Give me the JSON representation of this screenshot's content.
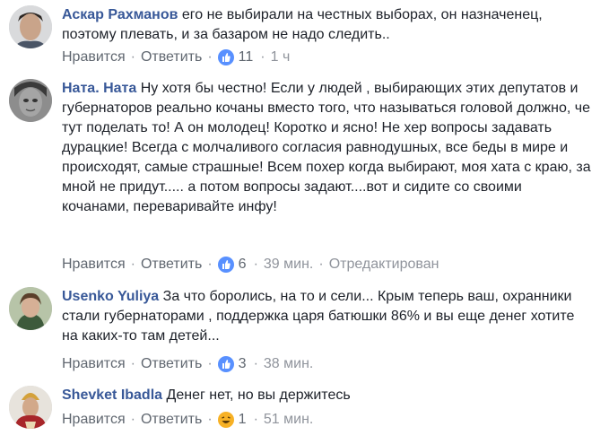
{
  "comments": [
    {
      "author": "Аскар Рахманов",
      "text": "его не выбирали на честных выборах, он назначенец, поэтому плевать, и за базаром не надо следить..",
      "like_label": "Нравится",
      "reply_label": "Ответить",
      "reaction": "like-icon",
      "reaction_count": "11",
      "time": "1 ч",
      "edited": ""
    },
    {
      "author": "Ната. Ната",
      "text": "Ну хотя бы честно! Если у людей , выбирающих этих депутатов и губернаторов реально кочаны вместо того, что называться головой должно, че тут поделать то! А он молодец! Коротко и ясно! Не хер вопросы задавать дурацкие! Всегда с молчаливого согласия равнодушных, все беды в мире и происходят, самые страшные! Всем похер когда выбирают, моя хата с краю, за мной не придут..... а потом вопросы задают....вот и сидите со своими кочанами, переваривайте инфу!",
      "like_label": "Нравится",
      "reply_label": "Ответить",
      "reaction": "like-icon",
      "reaction_count": "6",
      "time": "39 мин.",
      "edited": "Отредактирован"
    },
    {
      "author": "Usenko Yuliya",
      "text": "За что боролись, на то и сели... Крым теперь ваш, охранники стали губернаторами , поддержка царя батюшки 86% и вы еще денег хотите на каких-то там детей...",
      "like_label": "Нравится",
      "reply_label": "Ответить",
      "reaction": "like-icon",
      "reaction_count": "3",
      "time": "38 мин.",
      "edited": ""
    },
    {
      "author": "Shevket Ibadla",
      "text": "Денег нет, но вы держитесь",
      "like_label": "Нравится",
      "reply_label": "Ответить",
      "reaction": "haha-icon",
      "reaction_count": "1",
      "time": "51 мин.",
      "edited": ""
    }
  ],
  "colors": {
    "author": "#385898",
    "text": "#1d2129",
    "meta": "#90949c",
    "like": "#5890ff",
    "haha": "#f7b125"
  }
}
